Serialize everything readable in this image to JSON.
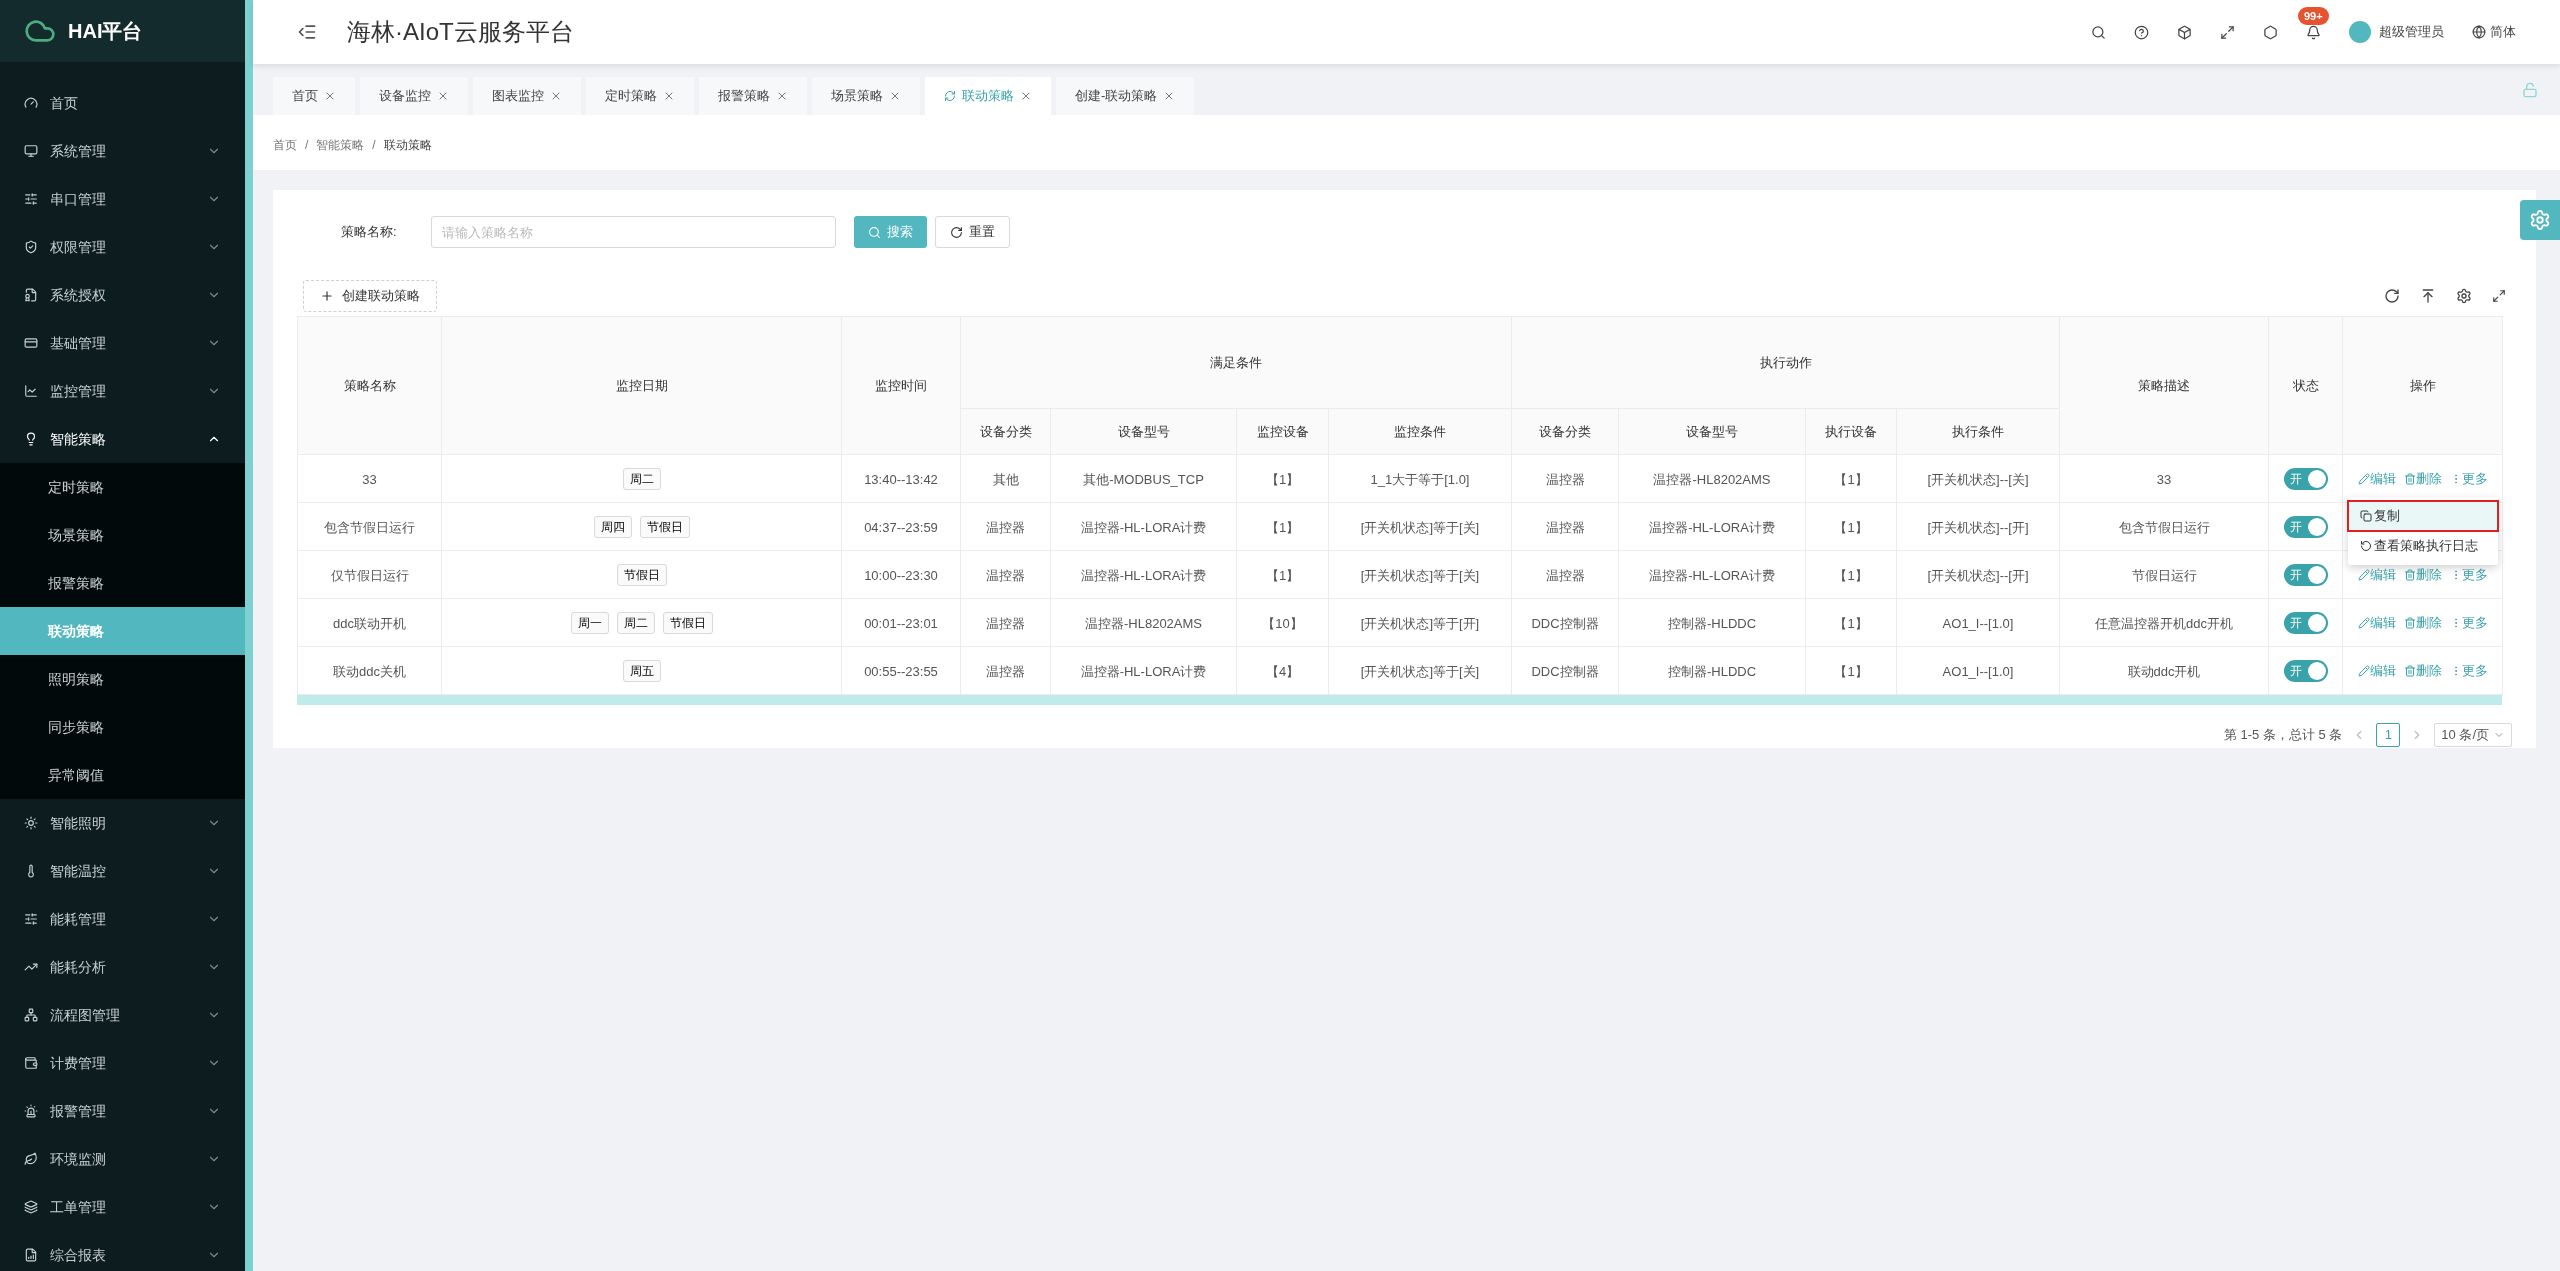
{
  "app": {
    "name": "HAI平台",
    "title": "海林·AIoT云服务平台"
  },
  "sidebar": {
    "items": [
      {
        "label": "首页"
      },
      {
        "label": "系统管理",
        "expanded": false
      },
      {
        "label": "串口管理",
        "expanded": false
      },
      {
        "label": "权限管理",
        "expanded": false
      },
      {
        "label": "系统授权",
        "expanded": false
      },
      {
        "label": "基础管理",
        "expanded": false
      },
      {
        "label": "监控管理",
        "expanded": false
      },
      {
        "label": "智能策略",
        "expanded": true,
        "children": [
          {
            "label": "定时策略",
            "selected": false
          },
          {
            "label": "场景策略",
            "selected": false
          },
          {
            "label": "报警策略",
            "selected": false
          },
          {
            "label": "联动策略",
            "selected": true
          },
          {
            "label": "照明策略",
            "selected": false
          },
          {
            "label": "同步策略",
            "selected": false
          },
          {
            "label": "异常阈值",
            "selected": false
          }
        ]
      },
      {
        "label": "智能照明",
        "expanded": false
      },
      {
        "label": "智能温控",
        "expanded": false
      },
      {
        "label": "能耗管理",
        "expanded": false
      },
      {
        "label": "能耗分析",
        "expanded": false
      },
      {
        "label": "流程图管理",
        "expanded": false
      },
      {
        "label": "计费管理",
        "expanded": false
      },
      {
        "label": "报警管理",
        "expanded": false
      },
      {
        "label": "环境监测",
        "expanded": false
      },
      {
        "label": "工单管理",
        "expanded": false
      },
      {
        "label": "综合报表",
        "expanded": false
      }
    ]
  },
  "header": {
    "notifications": "99+",
    "user": "超级管理员",
    "language": "简体"
  },
  "tabs": [
    {
      "label": "首页",
      "selected": false
    },
    {
      "label": "设备监控",
      "selected": false
    },
    {
      "label": "图表监控",
      "selected": false
    },
    {
      "label": "定时策略",
      "selected": false
    },
    {
      "label": "报警策略",
      "selected": false
    },
    {
      "label": "场景策略",
      "selected": false
    },
    {
      "label": "联动策略",
      "selected": true
    },
    {
      "label": "创建-联动策略",
      "selected": false
    }
  ],
  "breadcrumb": {
    "items": [
      "首页",
      "智能策略",
      "联动策略"
    ],
    "separators": [
      "/",
      "/"
    ]
  },
  "search": {
    "label": "策略名称:",
    "placeholder": "请输入策略名称",
    "search_button": "搜索",
    "reset_button": "重置"
  },
  "create_button": "创建联动策略",
  "table": {
    "groups": [
      "满足条件",
      "执行动作"
    ],
    "columns": [
      "策略名称",
      "监控日期",
      "监控时间",
      "设备分类",
      "设备型号",
      "监控设备",
      "监控条件",
      "设备分类",
      "设备型号",
      "执行设备",
      "执行条件",
      "策略描述",
      "状态",
      "操作"
    ],
    "rows": [
      {
        "name": "33",
        "days": [
          "周二"
        ],
        "time": "13:40--13:42",
        "cond_type": "其他",
        "cond_model": "其他-MODBUS_TCP",
        "cond_device": "【1】",
        "condition": "1_1大于等于[1.0]",
        "act_type": "温控器",
        "act_model": "温控器-HL8202AMS",
        "act_device": "【1】",
        "action": "[开关机状态]--[关]",
        "description": "33",
        "switch": {
          "label": "开",
          "on": true
        },
        "actions": [
          "编辑",
          "删除",
          "更多"
        ]
      },
      {
        "name": "包含节假日运行",
        "days": [
          "周四",
          "节假日"
        ],
        "time": "04:37--23:59",
        "cond_type": "温控器",
        "cond_model": "温控器-HL-LORA计费",
        "cond_device": "【1】",
        "condition": "[开关机状态]等于[关]",
        "act_type": "温控器",
        "act_model": "温控器-HL-LORA计费",
        "act_device": "【1】",
        "action": "[开关机状态]--[开]",
        "description": "包含节假日运行",
        "switch": {
          "label": "开",
          "on": true
        }
      },
      {
        "name": "仅节假日运行",
        "days": [
          "节假日"
        ],
        "time": "10:00--23:30",
        "cond_type": "温控器",
        "cond_model": "温控器-HL-LORA计费",
        "cond_device": "【1】",
        "condition": "[开关机状态]等于[关]",
        "act_type": "温控器",
        "act_model": "温控器-HL-LORA计费",
        "act_device": "【1】",
        "action": "[开关机状态]--[开]",
        "description": "节假日运行",
        "switch": {
          "label": "开",
          "on": true
        },
        "actions": [
          "编辑",
          "删除",
          "更多"
        ]
      },
      {
        "name": "ddc联动开机",
        "days": [
          "周一",
          "周二",
          "节假日"
        ],
        "time": "00:01--23:01",
        "cond_type": "温控器",
        "cond_model": "温控器-HL8202AMS",
        "cond_device": "【10】",
        "condition": "[开关机状态]等于[开]",
        "act_type": "DDC控制器",
        "act_model": "控制器-HLDDC",
        "act_device": "【1】",
        "action": "AO1_I--[1.0]",
        "description": "任意温控器开机ddc开机",
        "switch": {
          "label": "开",
          "on": true
        },
        "actions": [
          "编辑",
          "删除",
          "更多"
        ]
      },
      {
        "name": "联动ddc关机",
        "days": [
          "周五"
        ],
        "time": "00:55--23:55",
        "cond_type": "温控器",
        "cond_model": "温控器-HL-LORA计费",
        "cond_device": "【4】",
        "condition": "[开关机状态]等于[关]",
        "act_type": "DDC控制器",
        "act_model": "控制器-HLDDC",
        "act_device": "【1】",
        "action": "AO1_I--[1.0]",
        "description": "联动ddc开机",
        "switch": {
          "label": "开",
          "on": true
        },
        "actions": [
          "编辑",
          "删除",
          "更多"
        ]
      }
    ]
  },
  "dropdown": {
    "open": true,
    "items": [
      {
        "label": "复制",
        "selected": true,
        "highlighted": true
      },
      {
        "label": "查看策略执行日志",
        "selected": false,
        "highlighted": false
      }
    ]
  },
  "pagination": {
    "summary": "第 1-5 条，总计 5 条",
    "pages": [
      {
        "label": "1",
        "selected": true
      }
    ],
    "page_size": "10 条/页"
  }
}
